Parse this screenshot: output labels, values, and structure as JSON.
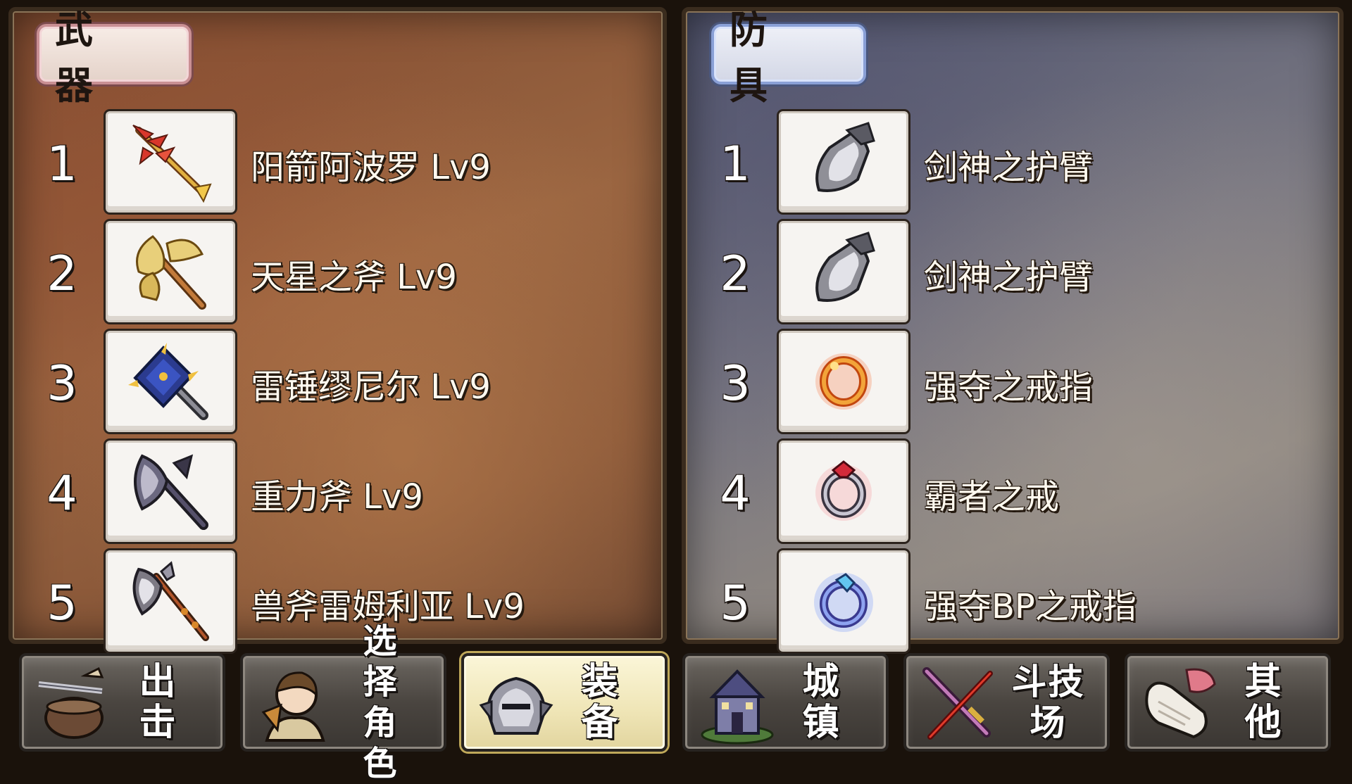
{
  "weapons": {
    "title": "武 器",
    "items": [
      {
        "num": "1",
        "name": "阳箭阿波罗 Lv9",
        "icon": "golden-arrow-icon"
      },
      {
        "num": "2",
        "name": "天星之斧 Lv9",
        "icon": "golden-battle-axe-icon"
      },
      {
        "num": "3",
        "name": "雷锤缪尼尔 Lv9",
        "icon": "thunder-hammer-icon"
      },
      {
        "num": "4",
        "name": "重力斧 Lv9",
        "icon": "dark-axe-icon"
      },
      {
        "num": "5",
        "name": "兽斧雷姆利亚 Lv9",
        "icon": "beast-halberd-icon"
      }
    ]
  },
  "armor": {
    "title": "防 具",
    "items": [
      {
        "num": "1",
        "name": "剑神之护臂",
        "icon": "silver-gauntlet-icon"
      },
      {
        "num": "2",
        "name": "剑神之护臂",
        "icon": "silver-gauntlet-icon"
      },
      {
        "num": "3",
        "name": "强夺之戒指",
        "icon": "gold-ring-icon"
      },
      {
        "num": "4",
        "name": "霸者之戒",
        "icon": "dragon-ring-icon"
      },
      {
        "num": "5",
        "name": "强夺BP之戒指",
        "icon": "blue-gem-ring-icon"
      }
    ]
  },
  "nav": {
    "sortie": "出 击",
    "select_line1": "选 择",
    "select_line2": "角 色",
    "equip": "装 备",
    "town": "城 镇",
    "arena": "斗技场",
    "other": "其 他",
    "active": "equip"
  },
  "colors": {
    "weapons_accent": "#c98f93",
    "armor_accent": "#8aa0d6",
    "active_button": "#efe5b6"
  }
}
